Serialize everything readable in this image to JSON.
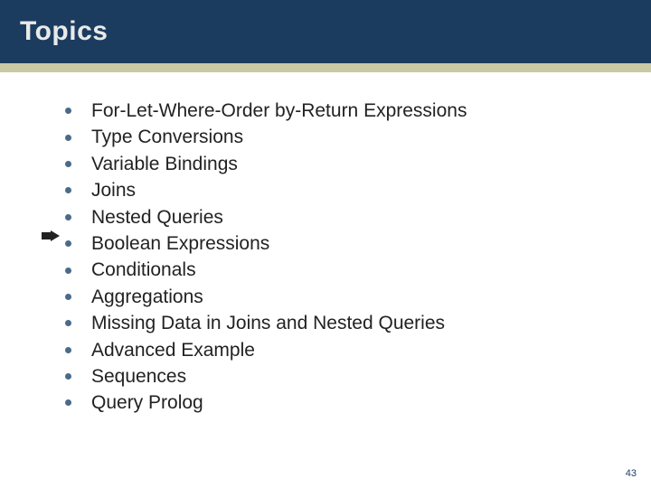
{
  "header": {
    "title": "Topics"
  },
  "pointer_index": 5,
  "bullets": [
    "For-Let-Where-Order by-Return Expressions",
    "Type Conversions",
    "Variable Bindings",
    "Joins",
    "Nested Queries",
    "Boolean Expressions",
    "Conditionals",
    "Aggregations",
    "Missing Data in Joins and Nested Queries",
    "Advanced Example",
    "Sequences",
    "Query Prolog"
  ],
  "page_number": "43"
}
